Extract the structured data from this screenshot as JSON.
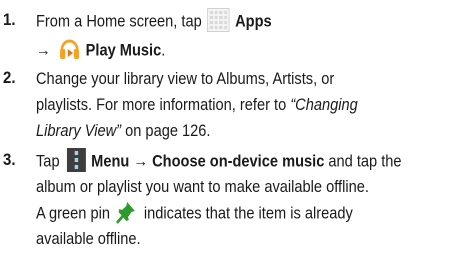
{
  "steps": [
    {
      "number": "1.",
      "lines": [
        {
          "t1": "From a Home screen, tap",
          "apps_label": "Apps"
        },
        {
          "arrow": "→",
          "play_music": "Play Music",
          "end": "."
        }
      ]
    },
    {
      "number": "2.",
      "lines": [
        "Change your library view to Albums, Artists, or",
        "playlists. For more information, refer to",
        {
          "italic": "Library View”",
          "rest": " on page 126."
        }
      ],
      "link_open": "“Changing"
    },
    {
      "number": "3.",
      "lines": [
        {
          "tap": "Tap",
          "menu_label": "Menu → Choose on-device music",
          "rest": " and tap the"
        },
        "album or playlist you want to make available offline.",
        {
          "pre": "A green pin",
          "post": "indicates that the item is already"
        },
        "available offline."
      ]
    }
  ],
  "icons": {
    "apps": "apps-grid-icon",
    "play_music": "play-music-icon",
    "menu": "menu-icon",
    "pin": "green-pin-icon"
  },
  "colors": {
    "music_orange": "#f5a323",
    "pin_green": "#2e9a2e",
    "menu_bg": "#3e3e3e"
  }
}
